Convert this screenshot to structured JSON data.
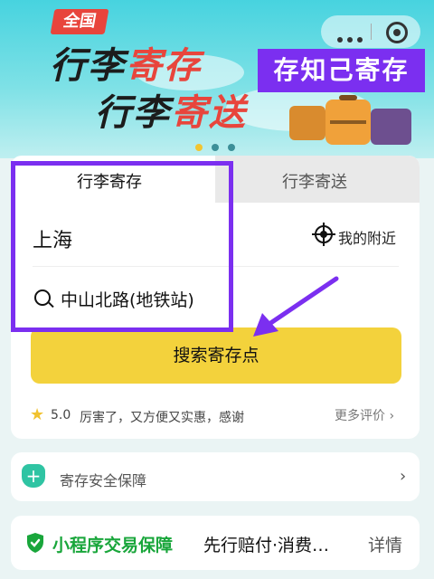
{
  "banner": {
    "badge": "全国",
    "line1_dark": "行李",
    "line1_red": "寄存",
    "line2_dark": "行李",
    "line2_red": "寄送",
    "promo_label": "存知己寄存",
    "carousel_active_index": 0,
    "carousel_count": 3
  },
  "tabs": {
    "storage_label": "行李寄存",
    "delivery_label": "行李寄送"
  },
  "form": {
    "city": "上海",
    "nearby_label": "我的附近",
    "search_value": "中山北路(地铁站)",
    "search_button": "搜索寄存点"
  },
  "reviews": {
    "rating": "5.0",
    "snippet": "厉害了，又方便又实惠，感谢",
    "more_label": "更多评价"
  },
  "safety": {
    "label": "寄存安全保障"
  },
  "mini_program": {
    "title": "小程序交易保障",
    "desc": "先行赔付·消费…",
    "detail_label": "详情"
  },
  "colors": {
    "accent_yellow": "#f3d23c",
    "highlight_purple": "#7b2ff0",
    "brand_red": "#e8453c",
    "mint": "#2fc4a3",
    "green": "#19a63b"
  }
}
